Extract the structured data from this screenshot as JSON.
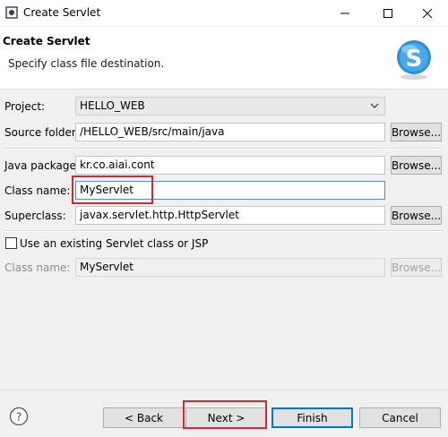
{
  "window": {
    "title": "Create Servlet",
    "minimize_icon": "minimize-icon",
    "maximize_icon": "maximize-icon",
    "close_icon": "close-icon"
  },
  "header": {
    "title": "Create Servlet",
    "description": "Specify class file destination.",
    "logo_icon": "servlet-wizard-logo",
    "logo_letter": "S"
  },
  "form": {
    "project": {
      "label": "Project:",
      "value": "HELLO_WEB"
    },
    "source_folder": {
      "label": "Source folder:",
      "value": "/HELLO_WEB/src/main/java",
      "browse": "Browse..."
    },
    "java_package": {
      "label": "Java package:",
      "value": "kr.co.aiai.cont",
      "browse": "Browse..."
    },
    "class_name": {
      "label": "Class name:",
      "value": "MyServlet"
    },
    "superclass": {
      "label": "Superclass:",
      "value": "javax.servlet.http.HttpServlet",
      "browse": "Browse..."
    },
    "use_existing": {
      "label": "Use an existing Servlet class or JSP",
      "checked": false
    },
    "existing_class_name": {
      "label": "Class name:",
      "value": "MyServlet",
      "browse": "Browse..."
    }
  },
  "footer": {
    "help_icon": "help-icon",
    "back": "< Back",
    "next": "Next >",
    "finish": "Finish",
    "cancel": "Cancel"
  },
  "colors": {
    "highlight": "#d9262b",
    "focus_border": "#5b8dd6",
    "default_button_border": "#0078d7"
  }
}
